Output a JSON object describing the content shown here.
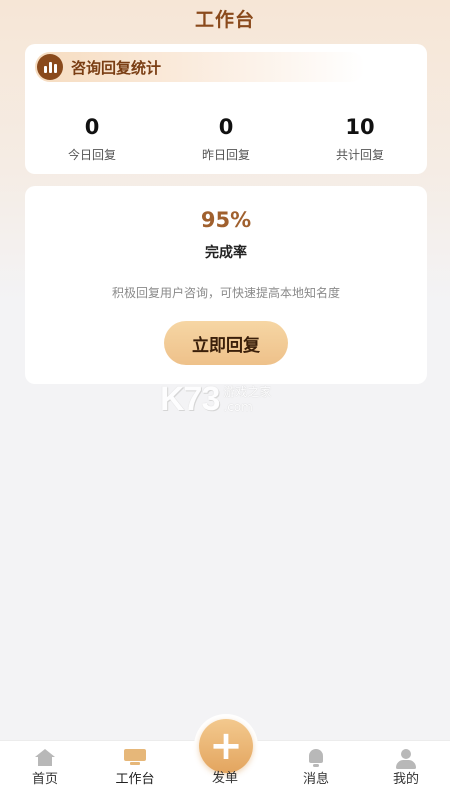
{
  "header": {
    "title": "工作台"
  },
  "stats": {
    "title": "咨询回复统计",
    "items": [
      {
        "value": "0",
        "label": "今日回复"
      },
      {
        "value": "0",
        "label": "昨日回复"
      },
      {
        "value": "10",
        "label": "共计回复"
      }
    ]
  },
  "completion": {
    "rate": "95%",
    "label": "完成率",
    "hint": "积极回复用户咨询，可快速提高本地知名度",
    "button_label": "立即回复"
  },
  "watermark": {
    "main": "K73",
    "line1": "游戏之家",
    "line2": ".com"
  },
  "tabbar": {
    "items": [
      {
        "label": "首页",
        "icon": "home-icon"
      },
      {
        "label": "工作台",
        "icon": "desk-icon"
      },
      {
        "label": "发单",
        "icon": "plus-icon"
      },
      {
        "label": "消息",
        "icon": "bell-icon"
      },
      {
        "label": "我的",
        "icon": "user-icon"
      }
    ]
  },
  "colors": {
    "accent": "#8a4a1c",
    "button": "#eec18a",
    "rate": "#a0602e"
  }
}
